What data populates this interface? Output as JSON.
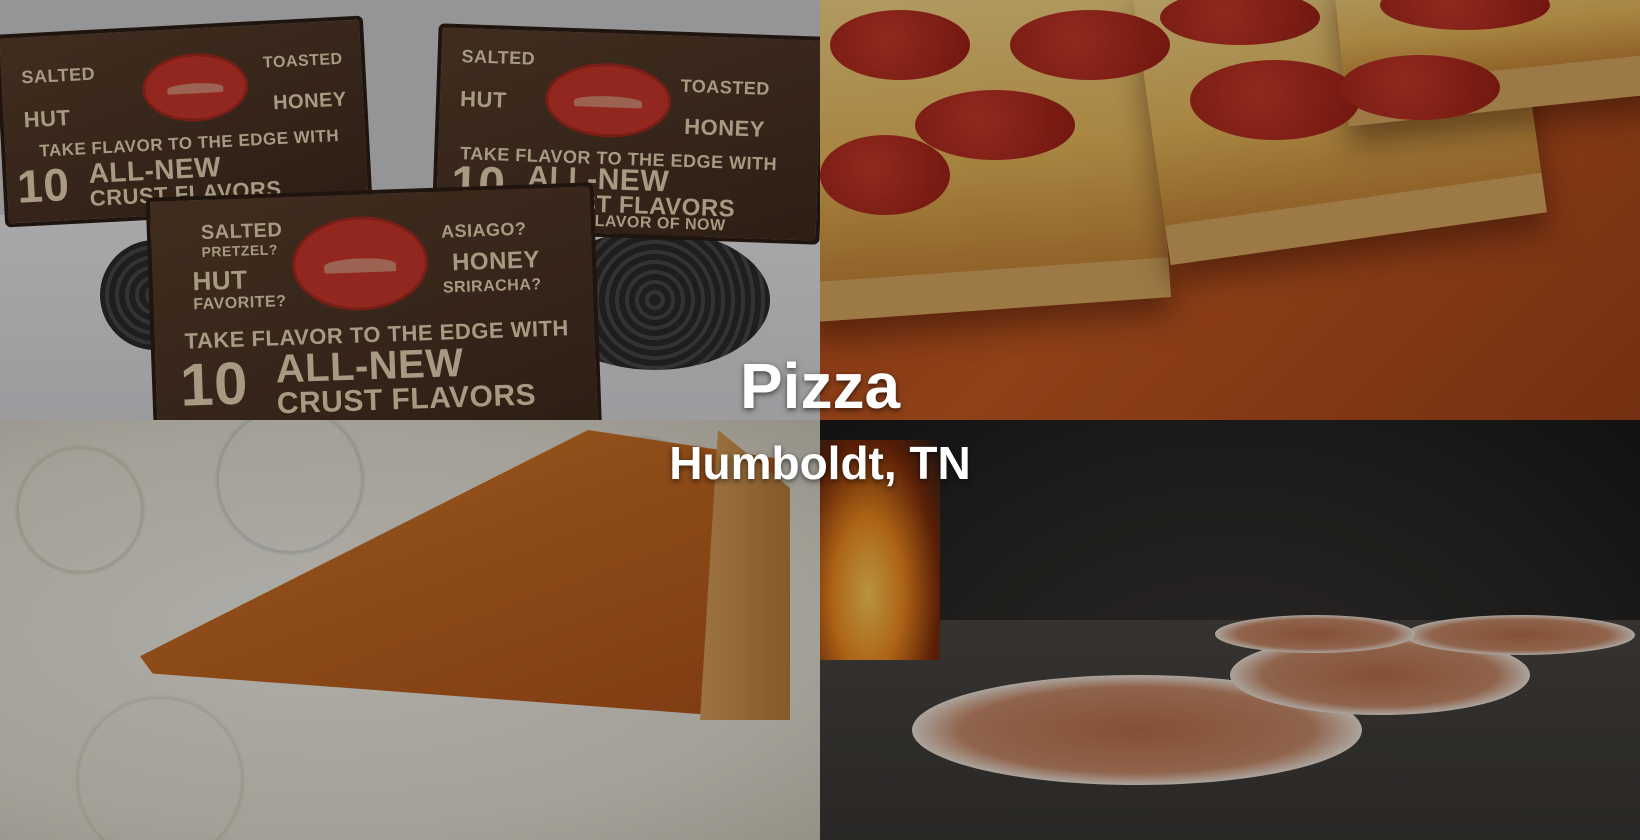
{
  "hero": {
    "title": "Pizza",
    "subtitle": "Humboldt, TN"
  },
  "tiles": [
    {
      "subject": "pizza boxes on stove"
    },
    {
      "subject": "pepperoni square pizza"
    },
    {
      "subject": "pizza slice on paper towel"
    },
    {
      "subject": "pizzas in wood-fired oven"
    }
  ],
  "box_print": {
    "line1": "SALTED",
    "line2": "PRETZEL?",
    "line3": "HUT",
    "line4": "FAVORITE?",
    "line5": "TOASTED",
    "line6": "ASIAGO?",
    "line7": "HONEY",
    "line8": "SRIRACHA?",
    "line9": "TAKE FLAVOR TO THE EDGE WITH",
    "line10": "10",
    "line11": "ALL-NEW",
    "line12": "CRUST FLAVORS",
    "line13": "THE FLAVOR OF NOW"
  },
  "colors": {
    "overlay_text": "#ffffff",
    "detroit_bg": "#c65a22",
    "box_brown": "#4a3323",
    "box_print": "#e7d6b4",
    "logo_red": "#c9362b"
  }
}
